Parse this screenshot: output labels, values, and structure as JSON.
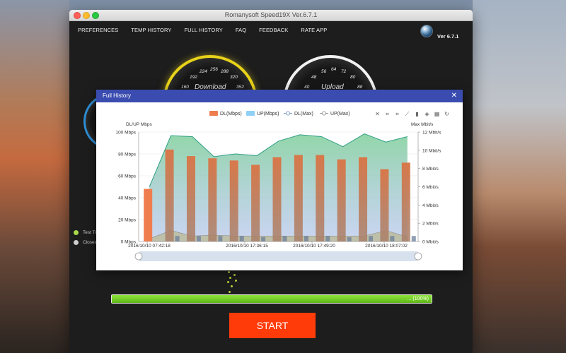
{
  "window": {
    "title": "Romanysoft Speed19X Ver.6.7.1"
  },
  "menu": {
    "items": [
      "PREFERENCES",
      "TEMP HISTORY",
      "FULL HISTORY",
      "FAQ",
      "FEEDBACK",
      "RATE APP"
    ],
    "version": "Ver 6.7.1"
  },
  "gauges": {
    "download": {
      "label": "Download",
      "ticks": [
        "160",
        "192",
        "224",
        "256",
        "288",
        "320",
        "352"
      ]
    },
    "upload": {
      "label": "Upload",
      "ticks": [
        "40",
        "48",
        "56",
        "64",
        "72",
        "80",
        "88"
      ]
    }
  },
  "legend_items": [
    "Test Tr",
    "Closes"
  ],
  "progress": {
    "label": "... (100%)",
    "fraction": 1.0
  },
  "start_label": "START",
  "dialog": {
    "title": "Full History",
    "close_icon": "close-icon",
    "toolbar_icons": [
      "zoom-reset-icon",
      "zoom-in-icon",
      "zoom-out-icon",
      "line-chart-icon",
      "bar-chart-icon",
      "stack-icon",
      "tiled-icon",
      "refresh-icon"
    ]
  },
  "chart_data": {
    "type": "bar",
    "left_axis_label": "DL/UP Mbps",
    "right_axis_label": "Max Mbit/s",
    "left_ticks": [
      "100 Mbps",
      "80 Mbps",
      "60 Mbps",
      "40 Mbps",
      "20 Mbps",
      "0 Mbps"
    ],
    "right_ticks": [
      "12 Mbit/s",
      "10 Mbit/s",
      "8 Mbit/s",
      "6 Mbit/s",
      "4 Mbit/s",
      "2 Mbit/s",
      "0 Mbit/s"
    ],
    "ylim_left": [
      0,
      100
    ],
    "ylim_right": [
      0,
      12
    ],
    "x_labels": [
      "2016/10/10 07:42:18",
      "2016/10/10 17:36:15",
      "2016/10/10 17:49:20",
      "2016/10/10 18:07:02"
    ],
    "legend": [
      "DL(Mbps)",
      "UP(Mbps)",
      "DL(Max)",
      "UP(Max)"
    ],
    "colors": {
      "dl": "#f07d4e",
      "up": "#8fd0f5",
      "dl_max": "#2f9e86",
      "up_max": "#8a8a8a"
    },
    "series": [
      {
        "name": "DL(Mbps)",
        "values": [
          48,
          84,
          78,
          76,
          74,
          70,
          77,
          79,
          79,
          75,
          77,
          66,
          72
        ]
      },
      {
        "name": "UP(Mbps)",
        "values": [
          0,
          5,
          5,
          5,
          5,
          4,
          5,
          5,
          5,
          4,
          5,
          5,
          5
        ]
      },
      {
        "name": "DL(Max)",
        "values": [
          6.0,
          11.6,
          11.5,
          9.3,
          9.6,
          9.4,
          11.0,
          11.7,
          11.5,
          10.4,
          11.8,
          10.9,
          11.5
        ]
      },
      {
        "name": "UP(Max)",
        "values": [
          0.3,
          1.2,
          0.6,
          0.7,
          0.6,
          0.6,
          0.6,
          0.6,
          0.6,
          0.6,
          0.6,
          1.2,
          0.5
        ]
      }
    ]
  }
}
